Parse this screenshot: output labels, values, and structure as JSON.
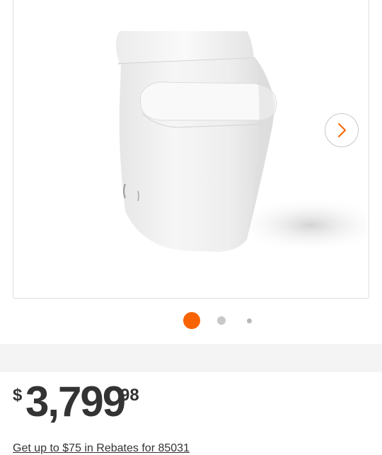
{
  "gallery": {
    "image_alt": "White one-piece smart toilet",
    "next_icon": "chevron-right-icon",
    "dots": [
      {
        "state": "active"
      },
      {
        "state": "inactive"
      },
      {
        "state": "inactive"
      }
    ],
    "accent_color": "#f96302"
  },
  "price": {
    "currency_symbol": "$",
    "dollars": "3,799",
    "cents": "98"
  },
  "rebate": {
    "label": "Get up to $75 in Rebates for 85031"
  }
}
